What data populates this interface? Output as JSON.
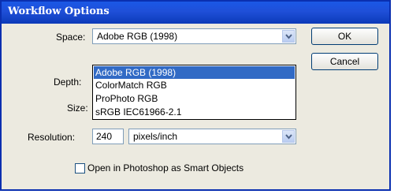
{
  "window": {
    "title": "Workflow Options"
  },
  "space": {
    "label": "Space:",
    "value": "Adobe RGB (1998)"
  },
  "space_options": [
    {
      "label": "Adobe RGB (1998)",
      "selected": true
    },
    {
      "label": "ColorMatch RGB",
      "selected": false
    },
    {
      "label": "ProPhoto RGB",
      "selected": false
    },
    {
      "label": "sRGB IEC61966-2.1",
      "selected": false
    }
  ],
  "depth": {
    "label": "Depth:"
  },
  "size": {
    "label": "Size:"
  },
  "resolution": {
    "label": "Resolution:",
    "value": "240",
    "unit": "pixels/inch"
  },
  "smart_objects": {
    "label": "Open in Photoshop as Smart Objects",
    "checked": false
  },
  "buttons": {
    "ok": "OK",
    "cancel": "Cancel"
  },
  "icons": {
    "dropdown": "chevron-down-icon"
  },
  "colors": {
    "titlebar": "#1f4fd8",
    "selection": "#316ac5",
    "dialog_bg": "#eceae0"
  }
}
